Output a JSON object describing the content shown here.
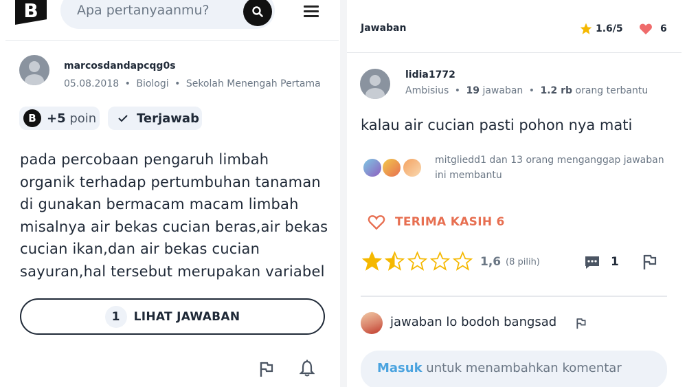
{
  "left": {
    "logo_letter": "B",
    "search": {
      "placeholder": "Apa pertanyaanmu?"
    },
    "question": {
      "username": "marcosdandapcqg0s",
      "date": "05.08.2018",
      "subject": "Biologi",
      "level": "Sekolah Menengah Pertama",
      "points_badge": "B",
      "points_value": "+5",
      "points_word": "poin",
      "status": "Terjawab",
      "lines": [
        "pada percobaan pengaruh limbah",
        "organik terhadap pertumbuhan tanaman",
        "di gunakan bermacam macam limbah",
        "misalnya air bekas cucian beras,air bekas",
        "cucian ikan,dan air bekas cucian",
        "sayuran,hal tersebut merupakan variabel"
      ],
      "answers_count": "1",
      "see_answer_label": "LIHAT JAWABAN"
    },
    "icons": [
      "search-icon",
      "menu-icon",
      "check-icon",
      "flag-icon",
      "bell-icon"
    ]
  },
  "right": {
    "header": {
      "title": "Jawaban",
      "rating": "1.6/5",
      "thanks": "6"
    },
    "answerer": {
      "username": "lidia1772",
      "rank": "Ambisius",
      "answers_num": "19",
      "answers_word": "jawaban",
      "helped_num": "1.2 rb",
      "helped_word": "orang terbantu"
    },
    "answer_text": "kalau air cucian pasti pohon nya mati",
    "helpful_line1": "mitglied d1 dan 13 orang menganggap jawaban",
    "helpful_line1_exact": "mitgliedd1 dan 13 orang menganggap jawaban",
    "helpful_line2": "ini membantu",
    "thanks_button": "TERIMA KASIH 6",
    "rating": {
      "value": "1,6",
      "votes": "(8 pilih)",
      "stars_filled": 1.5,
      "stars_total": 5
    },
    "comments_count": "1",
    "comment": {
      "text": "jawaban lo bodoh bangsad"
    },
    "comment_input": {
      "link": "Masuk",
      "rest": "untuk menambahkan komentar"
    },
    "colors": {
      "accent_blue": "#4aa3df",
      "star": "#f5b800",
      "heart": "#ef6b6b",
      "thanks": "#e76f51"
    }
  }
}
